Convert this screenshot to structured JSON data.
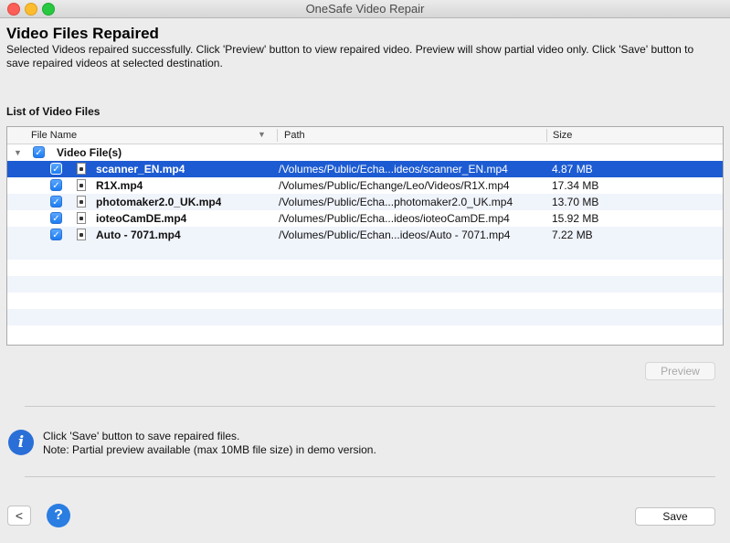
{
  "window": {
    "title": "OneSafe Video Repair"
  },
  "main": {
    "heading": "Video Files Repaired",
    "description": "Selected Videos repaired successfully. Click 'Preview' button to view repaired video. Preview will show partial video only. Click 'Save' button to save repaired videos at selected destination.",
    "list_label": "List of Video Files"
  },
  "table": {
    "columns": {
      "name": "File Name",
      "path": "Path",
      "size": "Size"
    },
    "root_label": "Video File(s)",
    "rows": [
      {
        "name": "scanner_EN.mp4",
        "path": "/Volumes/Public/Echa...ideos/scanner_EN.mp4",
        "size": "4.87 MB",
        "selected": true
      },
      {
        "name": "R1X.mp4",
        "path": "/Volumes/Public/Echange/Leo/Videos/R1X.mp4",
        "size": "17.34 MB",
        "selected": false
      },
      {
        "name": "photomaker2.0_UK.mp4",
        "path": "/Volumes/Public/Echa...photomaker2.0_UK.mp4",
        "size": "13.70 MB",
        "selected": false
      },
      {
        "name": "ioteoCamDE.mp4",
        "path": "/Volumes/Public/Echa...ideos/ioteoCamDE.mp4",
        "size": "15.92 MB",
        "selected": false
      },
      {
        "name": "Auto - 7071.mp4",
        "path": "/Volumes/Public/Echan...ideos/Auto - 7071.mp4",
        "size": "7.22 MB",
        "selected": false
      }
    ]
  },
  "buttons": {
    "preview": "Preview",
    "save": "Save",
    "back": "<",
    "help": "?"
  },
  "info": {
    "icon": "i",
    "line1": "Click 'Save' button to save repaired files.",
    "line2": "Note: Partial preview available (max 10MB file size) in demo version."
  },
  "colors": {
    "selection": "#1c5bd2",
    "accent": "#2a6fd7"
  }
}
